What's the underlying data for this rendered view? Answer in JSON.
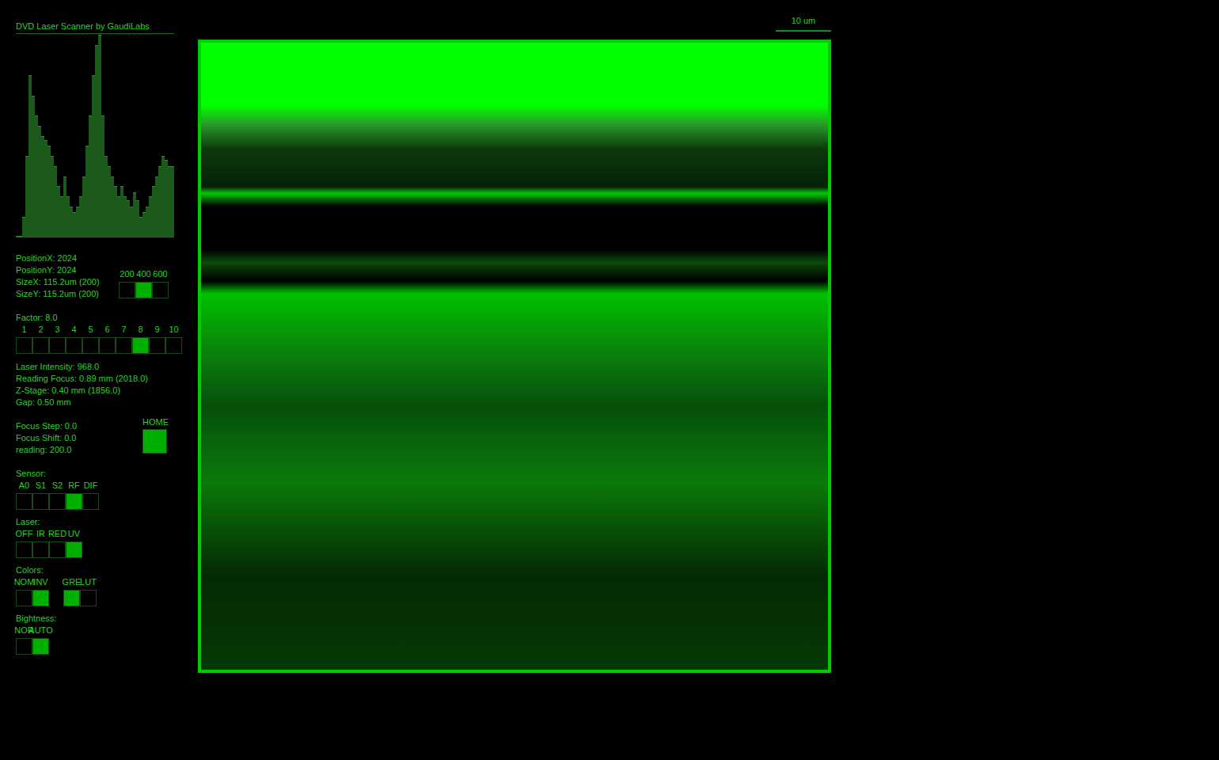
{
  "title": "DVD Laser Scanner by GaudiLabs",
  "histogram": {
    "values": [
      0,
      0,
      10,
      40,
      80,
      70,
      60,
      55,
      50,
      48,
      45,
      40,
      35,
      25,
      20,
      30,
      20,
      15,
      12,
      15,
      20,
      30,
      45,
      60,
      80,
      95,
      100,
      60,
      40,
      35,
      30,
      25,
      20,
      25,
      20,
      18,
      15,
      22,
      18,
      10,
      12,
      15,
      20,
      25,
      30,
      35,
      40,
      38,
      35,
      35
    ]
  },
  "position_lines": [
    "PositionX: 2024",
    "PositionY: 2024",
    "SizeX: 115.2um (200)",
    "SizeY: 115.2um (200)"
  ],
  "size_options": [
    {
      "label": "200",
      "selected": false
    },
    {
      "label": "400",
      "selected": true
    },
    {
      "label": "600",
      "selected": false
    }
  ],
  "factor": {
    "label": "Factor: 8.0",
    "options": [
      {
        "label": "1",
        "selected": false
      },
      {
        "label": "2",
        "selected": false
      },
      {
        "label": "3",
        "selected": false
      },
      {
        "label": "4",
        "selected": false
      },
      {
        "label": "5",
        "selected": false
      },
      {
        "label": "6",
        "selected": false
      },
      {
        "label": "7",
        "selected": false
      },
      {
        "label": "8",
        "selected": true
      },
      {
        "label": "9",
        "selected": false
      },
      {
        "label": "10",
        "selected": false
      }
    ]
  },
  "laser_lines": [
    "Laser Intensity: 968.0",
    "Reading Focus: 0.89 mm (2018.0)",
    "Z-Stage: 0.40 mm (1856.0)",
    "Gap: 0.50 mm"
  ],
  "focus_lines": [
    "Focus Step: 0.0",
    "Focus Shift: 0.0",
    "reading: 200.0"
  ],
  "home_button": {
    "label": "HOME"
  },
  "sensor": {
    "label": "Sensor:",
    "options": [
      {
        "label": "A0",
        "selected": false
      },
      {
        "label": "S1",
        "selected": false
      },
      {
        "label": "S2",
        "selected": false
      },
      {
        "label": "RF",
        "selected": true
      },
      {
        "label": "DIF",
        "selected": false
      }
    ]
  },
  "laser": {
    "label": "Laser:",
    "options": [
      {
        "label": "OFF",
        "selected": false
      },
      {
        "label": "IR",
        "selected": false
      },
      {
        "label": "RED",
        "selected": false
      },
      {
        "label": "UV",
        "selected": true
      }
    ]
  },
  "colors": {
    "label": "Colors:",
    "groups": [
      [
        {
          "label": "NOM",
          "selected": false
        },
        {
          "label": "INV",
          "selected": true
        }
      ],
      [
        {
          "label": "GRE",
          "selected": true
        },
        {
          "label": "LUT",
          "selected": false
        }
      ]
    ]
  },
  "brightness": {
    "label": "Bightness:",
    "options": [
      {
        "label": "NOR",
        "selected": false
      },
      {
        "label": "AUTO",
        "selected": true
      }
    ]
  },
  "scale_bar": "10 um"
}
